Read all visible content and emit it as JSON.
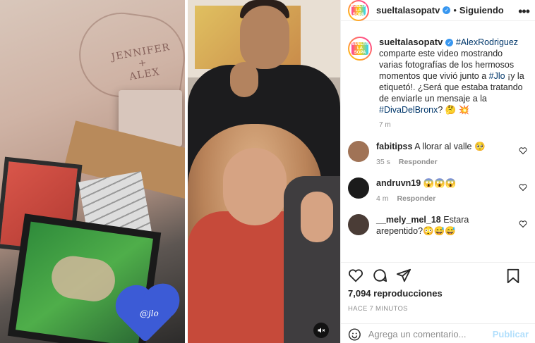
{
  "post": {
    "username": "sueltalasopatv",
    "following_label": "Siguiendo",
    "separator": "•",
    "avatar_logo_text": "SUELTA LA SOPA"
  },
  "caption": {
    "username": "sueltalasopatv",
    "mention": "#AlexRodriguez",
    "text_1": " comparte este video mostrando varias fotografías de los hermosos momentos que vivió junto a ",
    "hashtag_1": "#Jlo",
    "text_2": " ¡y la etiquetó!. ¿Será que estaba tratando de enviarle un mensaje a la ",
    "hashtag_2": "#DivaDelBronx",
    "text_3": "? 🤔 💥",
    "time": "7 m"
  },
  "comments": [
    {
      "username": "fabitipss",
      "text": "A llorar al valle 🥺",
      "time": "35 s",
      "reply_label": "Responder",
      "avatar_color": "#a07356"
    },
    {
      "username": "andruvn19",
      "text": "😱😱😱",
      "time": "4 m",
      "reply_label": "Responder",
      "avatar_color": "#1b1b1b"
    },
    {
      "username": "__mely_mel_18",
      "text": "Estara arepentido?😳😅😅",
      "time": "",
      "reply_label": "",
      "avatar_color": "#4a3c36"
    }
  ],
  "stats": {
    "views": "7,094 reproducciones",
    "time_ago": "HACE 7 MINUTOS"
  },
  "add_comment": {
    "placeholder": "Agrega un comentario...",
    "publish_label": "Publicar"
  },
  "media": {
    "carved_names": [
      "JENNIFER",
      "+",
      "ALEX"
    ],
    "sticker_text": "@jlo"
  },
  "colors": {
    "verified": "#3897f0",
    "link": "#00376b",
    "publish_disabled": "#b2dffc"
  }
}
